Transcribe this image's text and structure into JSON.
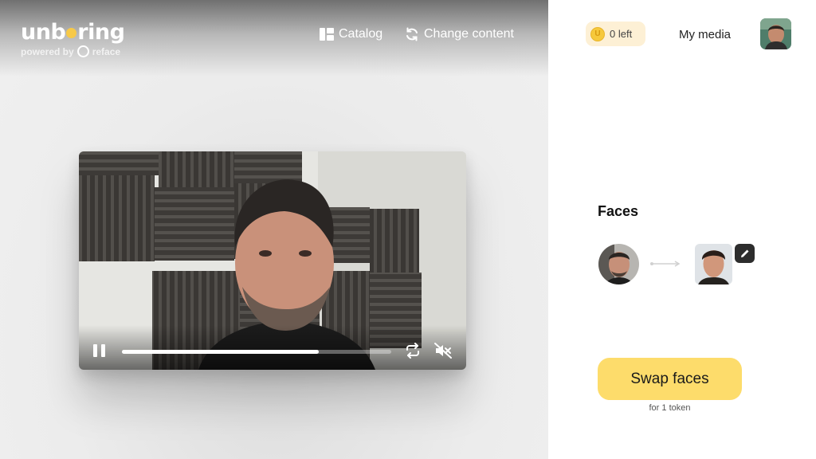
{
  "header": {
    "logo_text_a": "unb",
    "logo_text_b": "ring",
    "logo_subtitle": "powered by",
    "logo_brand": "reface",
    "nav": {
      "catalog_label": "Catalog",
      "change_content_label": "Change content"
    }
  },
  "video": {
    "progress": 0.73,
    "state": "playing",
    "muted": true,
    "icons": {
      "pause": "pause-icon",
      "repeat": "repeat-icon",
      "mute": "volume-muted-icon"
    }
  },
  "panel": {
    "tokens_label": "0 left",
    "coin_symbol": "U",
    "my_media_label": "My media",
    "faces_title": "Faces",
    "swap_button_label": "Swap faces",
    "swap_note": "for 1 token"
  },
  "colors": {
    "accent_yellow": "#fddc6b",
    "token_bg": "#fdf0d5",
    "edit_button": "#2d2d2d"
  }
}
